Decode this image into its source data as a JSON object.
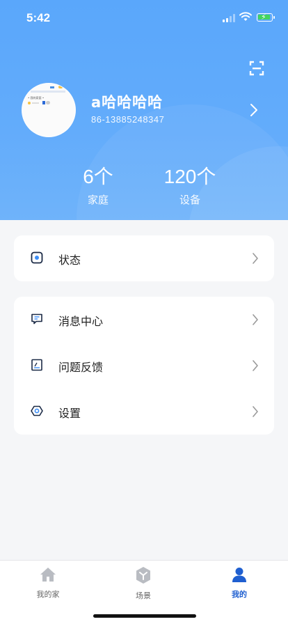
{
  "status_bar": {
    "time": "5:42"
  },
  "profile": {
    "name": "a哈哈哈哈",
    "phone": "86-13885248347",
    "avatar_lines": [
      "• 我的家庭 •",
      "-- ■ ◐"
    ]
  },
  "stats": [
    {
      "value": "6个",
      "label": "家庭"
    },
    {
      "value": "120个",
      "label": "设备"
    }
  ],
  "menu": {
    "group1": [
      {
        "label": "状态",
        "icon": "status-icon"
      }
    ],
    "group2": [
      {
        "label": "消息中心",
        "icon": "message-icon"
      },
      {
        "label": "问题反馈",
        "icon": "feedback-icon"
      },
      {
        "label": "设置",
        "icon": "settings-icon"
      }
    ]
  },
  "tabs": [
    {
      "label": "我的家",
      "icon": "home-icon",
      "active": false
    },
    {
      "label": "场景",
      "icon": "scene-icon",
      "active": false
    },
    {
      "label": "我的",
      "icon": "profile-icon",
      "active": true
    }
  ],
  "colors": {
    "accent": "#1f5fd0",
    "header": "#5aa7fb",
    "background": "#f5f6f8"
  }
}
